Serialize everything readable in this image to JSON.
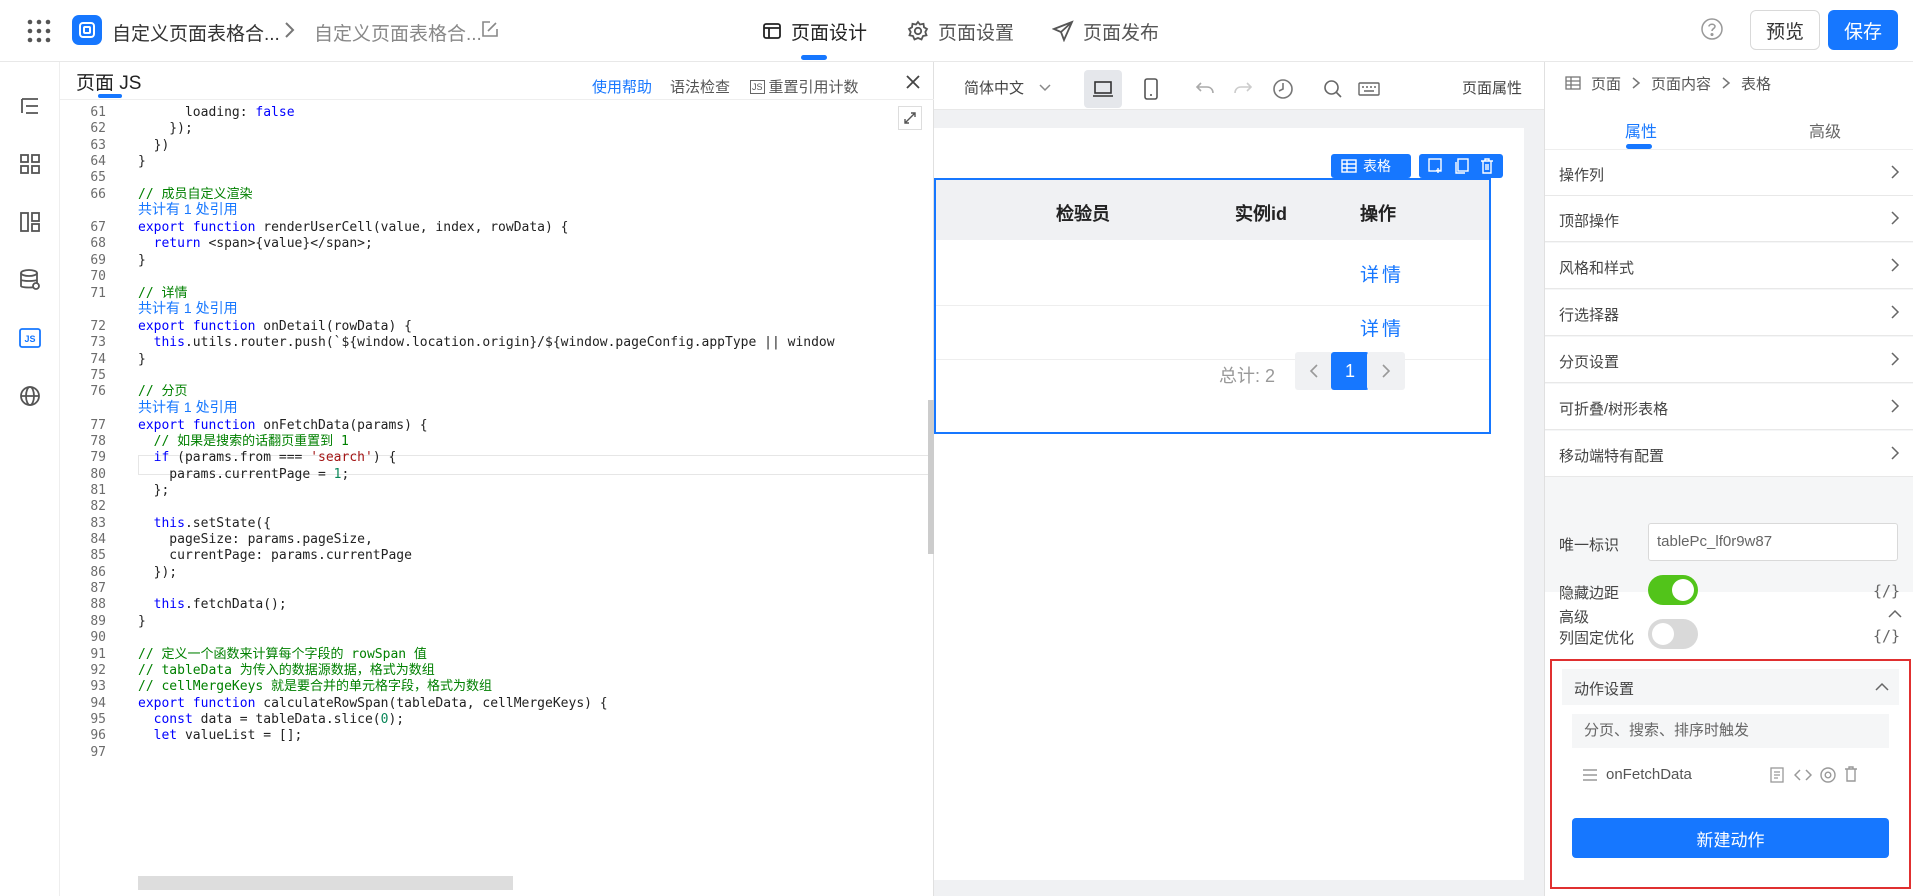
{
  "topbar": {
    "app_title": "自定义页面表格合...",
    "page_title": "自定义页面表格合...",
    "tabs": [
      {
        "label": "页面设计",
        "icon": "layout-icon",
        "active": true
      },
      {
        "label": "页面设置",
        "icon": "gear-icon",
        "active": false
      },
      {
        "label": "页面发布",
        "icon": "send-icon",
        "active": false
      }
    ],
    "preview_label": "预览",
    "save_label": "保存"
  },
  "rail": {
    "icons": [
      "outline-icon",
      "components-icon",
      "layout-panels-icon",
      "datasource-icon",
      "js-icon",
      "globe-icon"
    ],
    "js_label": "JS"
  },
  "js_panel": {
    "title": "页面 JS",
    "help": "使用帮助",
    "lint": "语法检查",
    "reset_refs": "重置引用计数",
    "js_badge": "JS",
    "ref_lens": "共计有 1 处引用",
    "code_lines": [
      {
        "n": "61",
        "code": "      loading: false"
      },
      {
        "n": "62",
        "code": "    });"
      },
      {
        "n": "63",
        "code": "  })"
      },
      {
        "n": "64",
        "code": "}"
      },
      {
        "n": "65",
        "code": ""
      },
      {
        "n": "66",
        "code": "// 成员自定义渲染"
      },
      {
        "n": "67",
        "code": "export function renderUserCell(value, index, rowData) {"
      },
      {
        "n": "68",
        "code": "  return <span>{value}</span>;"
      },
      {
        "n": "69",
        "code": "}"
      },
      {
        "n": "70",
        "code": ""
      },
      {
        "n": "71",
        "code": "// 详情"
      },
      {
        "n": "72",
        "code": "export function onDetail(rowData) {"
      },
      {
        "n": "73",
        "code": "  this.utils.router.push(`${window.location.origin}/${window.pageConfig.appType || window"
      },
      {
        "n": "74",
        "code": "}"
      },
      {
        "n": "75",
        "code": ""
      },
      {
        "n": "76",
        "code": "// 分页"
      },
      {
        "n": "77",
        "code": "export function onFetchData(params) {"
      },
      {
        "n": "78",
        "code": "  // 如果是搜索的话翻页重置到 1"
      },
      {
        "n": "79",
        "code": "  if (params.from === 'search') {"
      },
      {
        "n": "80",
        "code": "    params.currentPage = 1;"
      },
      {
        "n": "81",
        "code": "  };"
      },
      {
        "n": "82",
        "code": ""
      },
      {
        "n": "83",
        "code": "  this.setState({"
      },
      {
        "n": "84",
        "code": "    pageSize: params.pageSize,"
      },
      {
        "n": "85",
        "code": "    currentPage: params.currentPage"
      },
      {
        "n": "86",
        "code": "  });"
      },
      {
        "n": "87",
        "code": ""
      },
      {
        "n": "88",
        "code": "  this.fetchData();"
      },
      {
        "n": "89",
        "code": "}"
      },
      {
        "n": "90",
        "code": ""
      },
      {
        "n": "91",
        "code": "// 定义一个函数来计算每个字段的 rowSpan 值"
      },
      {
        "n": "92",
        "code": "// tableData 为传入的数据源数据，格式为数组"
      },
      {
        "n": "93",
        "code": "// cellMergeKeys 就是要合并的单元格字段，格式为数组"
      },
      {
        "n": "94",
        "code": "export function calculateRowSpan(tableData, cellMergeKeys) {"
      },
      {
        "n": "95",
        "code": "  const data = tableData.slice(0);"
      },
      {
        "n": "96",
        "code": "  let valueList = [];"
      },
      {
        "n": "97",
        "code": ""
      }
    ]
  },
  "canvas": {
    "language": "简体中文",
    "page_props": "页面属性",
    "table_badge": "表格",
    "columns": [
      "检验员",
      "实例id",
      "操作"
    ],
    "rows": [
      {
        "action": "详情"
      },
      {
        "action": "详情"
      }
    ],
    "total_text": "总计: 2",
    "current_page": "1"
  },
  "props": {
    "breadcrumb": [
      "页面",
      "页面内容",
      "表格"
    ],
    "tabs": [
      "属性",
      "高级"
    ],
    "sections": [
      "操作列",
      "顶部操作",
      "风格和样式",
      "行选择器",
      "分页设置",
      "可折叠/树形表格",
      "移动端特有配置"
    ],
    "advanced": {
      "label": "高级",
      "unique_id_label": "唯一标识",
      "unique_id_value": "tablePc_lf0r9w87",
      "hide_margin_label": "隐藏边距",
      "hide_margin_on": true,
      "fixed_col_label": "列固定优化",
      "fixed_col_on": false,
      "var_btn": "{/}"
    },
    "actions": {
      "title": "动作设置",
      "trigger": "分页、搜索、排序时触发",
      "handler": "onFetchData",
      "new_action": "新建动作"
    }
  },
  "colors": {
    "primary": "#1677ff",
    "toggle_on": "#52c41a",
    "highlight": "#e03030"
  }
}
